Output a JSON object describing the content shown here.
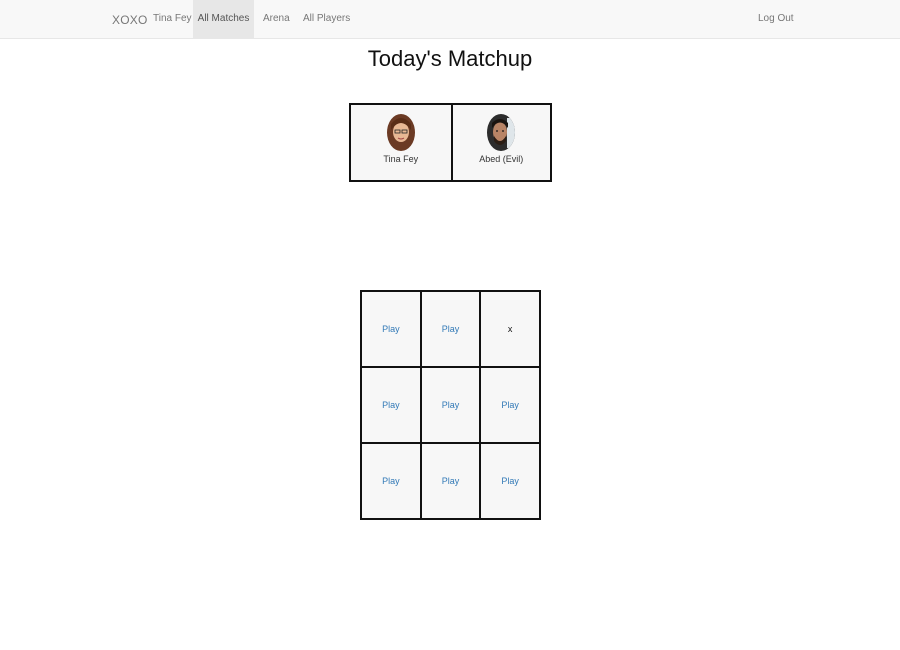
{
  "nav": {
    "brand": "XOXO",
    "current_user": "Tina Fey",
    "all_matches": "All Matches",
    "arena": "Arena",
    "all_players": "All Players",
    "logout": "Log Out"
  },
  "page": {
    "title": "Today's Matchup"
  },
  "matchup": {
    "players": [
      {
        "name": "Tina Fey",
        "avatar": "avatar-tina-fey"
      },
      {
        "name": "Abed (Evil)",
        "avatar": "avatar-abed-evil"
      }
    ]
  },
  "board": {
    "play_label": "Play",
    "cells": [
      "Play",
      "Play",
      "x",
      "Play",
      "Play",
      "Play",
      "Play",
      "Play",
      "Play"
    ]
  },
  "colors": {
    "navbar_bg": "#f8f8f8",
    "active_nav_bg": "#e7e7e7",
    "link": "#337ab7",
    "border": "#111111",
    "cell_bg": "#f7f7f7"
  }
}
